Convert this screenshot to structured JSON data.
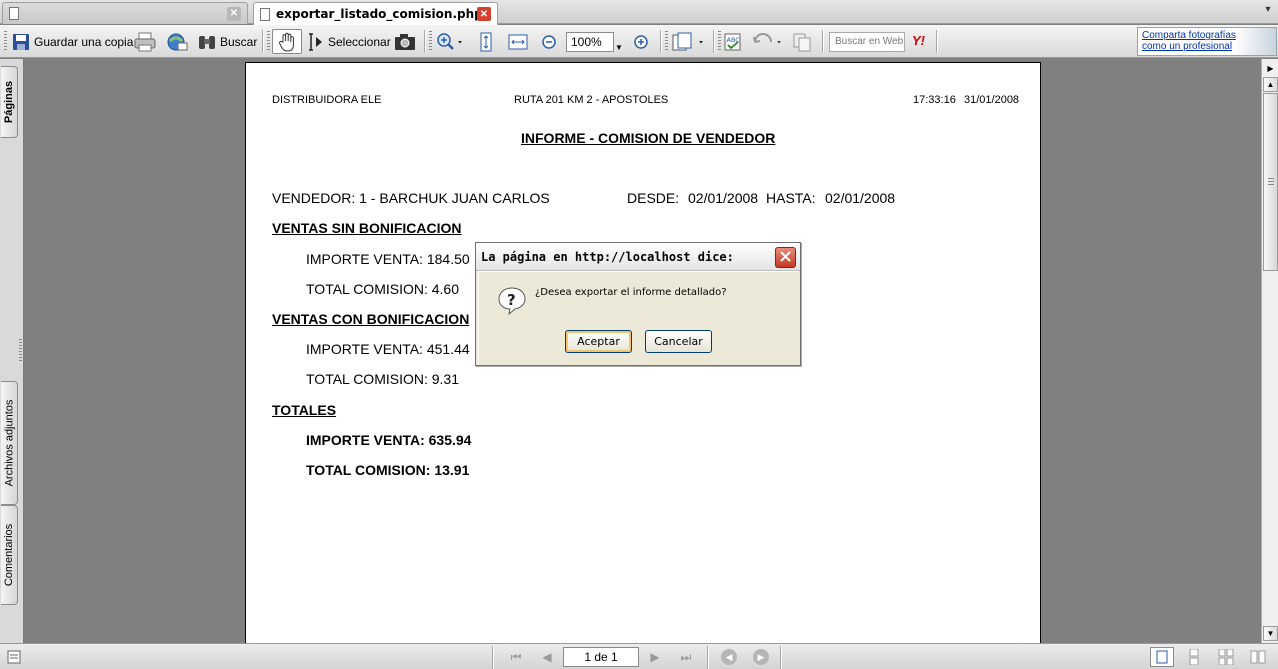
{
  "browser": {
    "tabs": [
      {
        "title": "",
        "active": false
      },
      {
        "title": "exportar_listado_comision.php (...",
        "active": true
      }
    ],
    "close_glyph": "✕",
    "tab_list_glyph": "▾"
  },
  "toolbar": {
    "save_copy": "Guardar una copia",
    "search": "Buscar",
    "select": "Seleccionar",
    "zoom_value": "100%",
    "web_search_placeholder": "Buscar en Web",
    "yahoo_label": "Y!",
    "ad_line1": "Comparta fotografías",
    "ad_line2": "como un profesional"
  },
  "side_tabs": {
    "pages": "Páginas",
    "attachments": "Archivos adjuntos",
    "comments": "Comentarios"
  },
  "report": {
    "company": "DISTRIBUIDORA ELE",
    "address": "RUTA 201 KM 2 - APOSTOLES",
    "time": "17:33:16",
    "date": "31/01/2008",
    "title": "INFORME - COMISION DE VENDEDOR",
    "vendor": "VENDEDOR: 1 - BARCHUK JUAN CARLOS",
    "from_label": "DESDE:",
    "from_date": "02/01/2008",
    "to_label": "HASTA:",
    "to_date": "02/01/2008",
    "sections": [
      {
        "heading": "VENTAS SIN BONIFICACION",
        "sales": "IMPORTE VENTA: 184.50",
        "commission": "TOTAL COMISION: 4.60"
      },
      {
        "heading": "VENTAS CON BONIFICACION",
        "sales": "IMPORTE VENTA: 451.44",
        "commission": "TOTAL COMISION: 9.31"
      },
      {
        "heading": "TOTALES",
        "sales": "IMPORTE VENTA: 635.94",
        "commission": "TOTAL COMISION: 13.91"
      }
    ]
  },
  "dialog": {
    "title": "La página en http://localhost dice:",
    "message": "¿Desea exportar el informe detallado?",
    "ok": "Aceptar",
    "cancel": "Cancelar"
  },
  "statusbar": {
    "page_indicator": "1 de 1"
  },
  "colors": {
    "doc_background": "#808080",
    "close_red": "#d8402e",
    "dialog_face": "#ece9d8",
    "default_button_glow": "#f3c66c"
  },
  "icons": [
    "document-icon",
    "save-icon",
    "print-icon",
    "email-icon",
    "binoculars-icon",
    "hand-icon",
    "select-text-icon",
    "snapshot-icon",
    "zoom-in-icon",
    "fit-height-icon",
    "fit-width-icon",
    "zoom-out-minus-icon",
    "zoom-plus-icon",
    "rotate-pages-icon",
    "spellcheck-icon",
    "undo-icon",
    "copy-icon",
    "question-icon",
    "first-page-icon",
    "previous-page-icon",
    "next-page-icon",
    "last-page-icon",
    "back-icon",
    "forward-icon"
  ]
}
